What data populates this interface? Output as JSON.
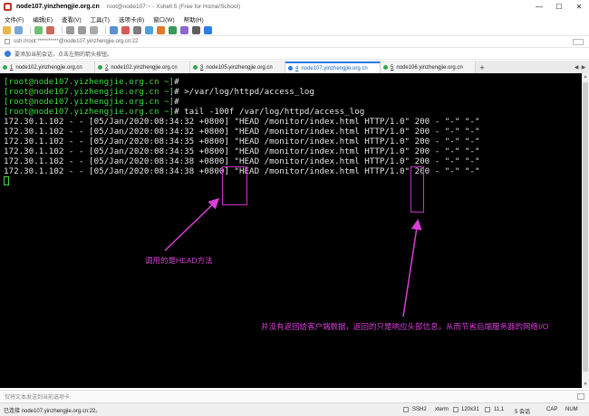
{
  "window": {
    "title": "node107.yinzhengjie.org.cn",
    "subtitle": "root@node107:~ - Xshell 5 (Free for Home/School)",
    "controls": {
      "minimize": "—",
      "maximize": "☐",
      "close": "✕"
    }
  },
  "menu": [
    "文件(F)",
    "编辑(E)",
    "查看(V)",
    "工具(T)",
    "选项卡(B)",
    "窗口(W)",
    "帮助(H)"
  ],
  "address": {
    "text": "ssh://root:**********@node107.yinzhengjie.org.cn:22"
  },
  "infobar": {
    "text": "要添加当前会话，点击左侧的箭头按钮。"
  },
  "tabs": [
    {
      "num": "1",
      "label": "node102.yinzhengjie.org.cn",
      "active": false
    },
    {
      "num": "2",
      "label": "node102.yinzhengjie.org.cn",
      "active": false
    },
    {
      "num": "3",
      "label": "node105.yinzhengjie.org.cn",
      "active": false
    },
    {
      "num": "4",
      "label": "node107.yinzhengjie.org.cn",
      "active": true
    },
    {
      "num": "5",
      "label": "node106.yinzhengjie.org.cn",
      "active": false
    }
  ],
  "tab_add": "+",
  "terminal": {
    "prompt": "[root@node107.yizhengjie.org.cn ~]",
    "lines": [
      {
        "prompt": "[root@node107.yizhengjie.org.cn ~]",
        "text": "#"
      },
      {
        "prompt": "[root@node107.yizhengjie.org.cn ~]",
        "text": "# >/var/log/httpd/access_log"
      },
      {
        "prompt": "[root@node107.yizhengjie.org.cn ~]",
        "text": "#"
      },
      {
        "prompt": "[root@node107.yizhengjie.org.cn ~]",
        "text": "# tail -100f /var/log/httpd/access_log"
      },
      {
        "prompt": "",
        "text": "172.30.1.102 - - [05/Jan/2020:08:34:32 +0800] \"HEAD /monitor/index.html HTTP/1.0\" 200 - \"-\" \"-\""
      },
      {
        "prompt": "",
        "text": "172.30.1.102 - - [05/Jan/2020:08:34:32 +0800] \"HEAD /monitor/index.html HTTP/1.0\" 200 - \"-\" \"-\""
      },
      {
        "prompt": "",
        "text": "172.30.1.102 - - [05/Jan/2020:08:34:35 +0800] \"HEAD /monitor/index.html HTTP/1.0\" 200 - \"-\" \"-\""
      },
      {
        "prompt": "",
        "text": "172.30.1.102 - - [05/Jan/2020:08:34:35 +0800] \"HEAD /monitor/index.html HTTP/1.0\" 200 - \"-\" \"-\""
      },
      {
        "prompt": "",
        "text": "172.30.1.102 - - [05/Jan/2020:08:34:38 +0800] \"HEAD /monitor/index.html HTTP/1.0\" 200 - \"-\" \"-\""
      },
      {
        "prompt": "",
        "text": "172.30.1.102 - - [05/Jan/2020:08:34:38 +0800] \"HEAD /monitor/index.html HTTP/1.0\" 200 - \"-\" \"-\""
      }
    ]
  },
  "annotations": {
    "head": "调用的是HEAD方法",
    "dash": "并没有返回给客户端数据，返回的只是响应头部信息，从而节省后端服务器的网络I/O",
    "color": "#d83fd8"
  },
  "compose": {
    "placeholder": "仅将文本发送到当前选项卡"
  },
  "status": {
    "left": "已连接 node107.yinzhengjie.org.cn:22。",
    "protocol": "SSH2",
    "term": "xterm",
    "size": "120x31",
    "pos": "11,1",
    "sessions": "5 会话",
    "caps": "CAP",
    "num": "NUM"
  }
}
